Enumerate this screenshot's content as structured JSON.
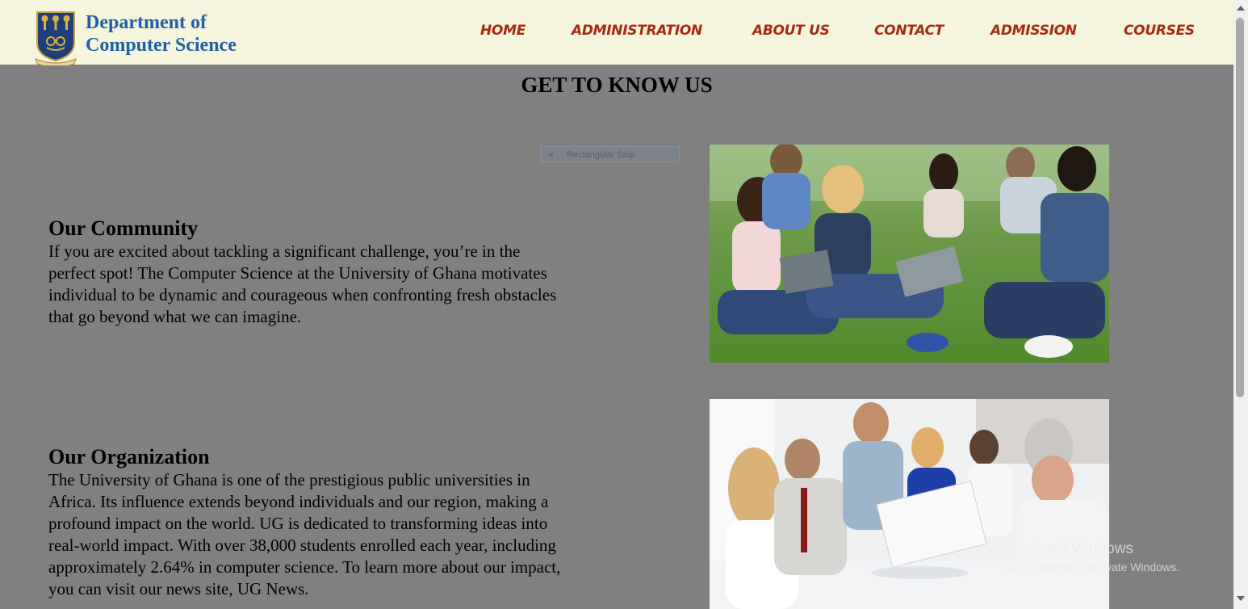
{
  "header": {
    "brand_line1": "Department of",
    "brand_line2": "Computer Science",
    "nav": [
      {
        "label": "HOME"
      },
      {
        "label": "ADMINISTRATION"
      },
      {
        "label": "ABOUT US"
      },
      {
        "label": "CONTACT"
      },
      {
        "label": "ADMISSION"
      },
      {
        "label": "COURSES"
      }
    ],
    "nav_color": "#a52a14",
    "brand_color": "#1e5fa6"
  },
  "main": {
    "title": "GET TO KNOW US",
    "sections": [
      {
        "heading": "Our Community",
        "lines": [
          "If you are excited about tackling a significant challenge, you’re in the",
          "perfect spot! The Computer Science at the University of Ghana motivates",
          "individual to be dynamic and courageous when confronting fresh obstacles",
          "that go beyond what we can imagine."
        ]
      },
      {
        "heading": "Our Organization",
        "lines": [
          "The University of Ghana is one of the prestigious public universities in",
          "Africa. Its influence extends beyond individuals and our region, making a",
          "profound impact on the world. UG is dedicated to transforming ideas into",
          "real-world impact. With over 38,000 students enrolled each year, including",
          "approximately 2.64% in computer science. To learn more about our impact,",
          "you can visit our news site, UG News."
        ]
      }
    ]
  },
  "overlay": {
    "snip_label": "Rectangular Snip",
    "watermark_line1": "Activate Windows",
    "watermark_line2": "Go to Settings to activate Windows."
  }
}
